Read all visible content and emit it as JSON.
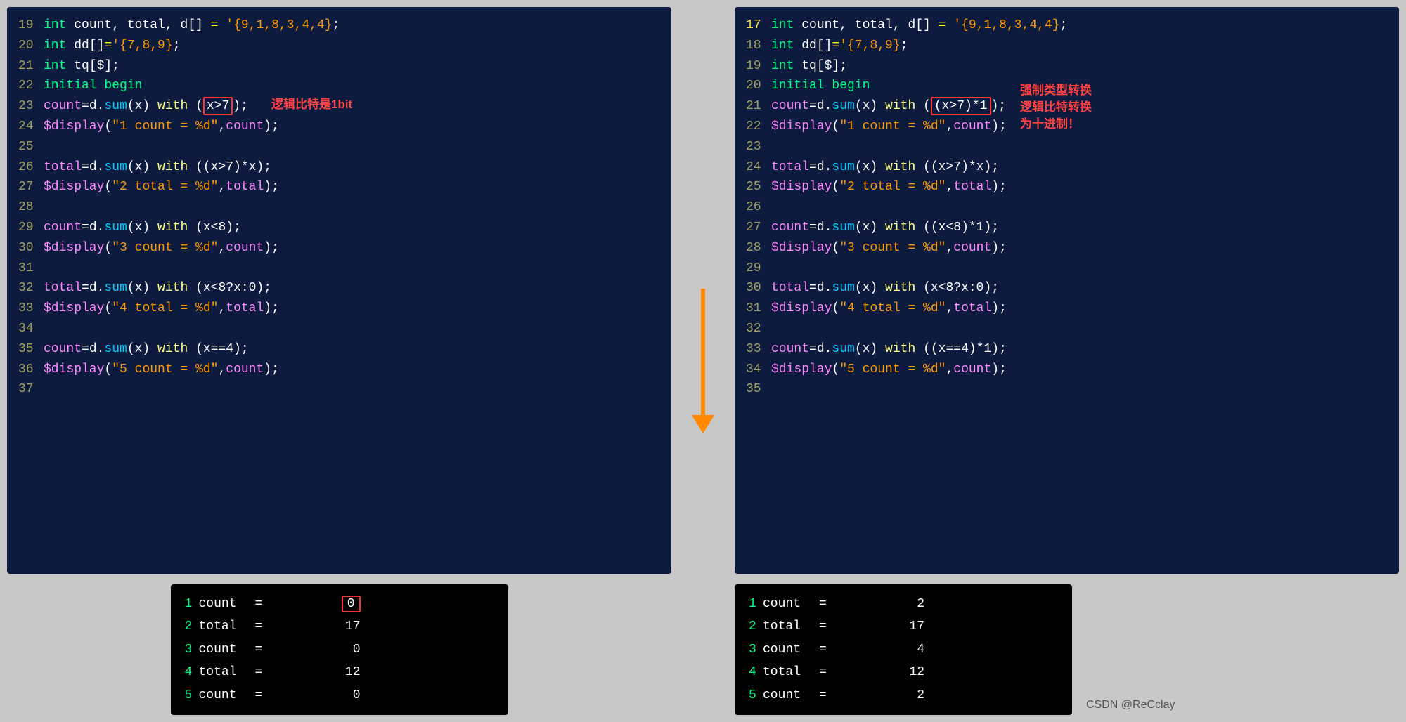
{
  "left": {
    "code": {
      "lines": [
        {
          "num": "19",
          "text": "int count, total, d[] = '{9,1,8,3,4,4};"
        },
        {
          "num": "20",
          "text": "int dd[]='{7,8,9};"
        },
        {
          "num": "21",
          "text": "int tq[$];"
        },
        {
          "num": "22",
          "text": "initial begin"
        },
        {
          "num": "23",
          "text": "count=d.sum(x) with (x>7);"
        },
        {
          "num": "24",
          "text": "$display(\"1 count = %d\",count);"
        },
        {
          "num": "25",
          "text": ""
        },
        {
          "num": "26",
          "text": "total=d.sum(x) with ((x>7)*x);"
        },
        {
          "num": "27",
          "text": "$display(\"2 total = %d\",total);"
        },
        {
          "num": "28",
          "text": ""
        },
        {
          "num": "29",
          "text": "count=d.sum(x) with (x<8);"
        },
        {
          "num": "30",
          "text": "$display(\"3 count = %d\",count);"
        },
        {
          "num": "31",
          "text": ""
        },
        {
          "num": "32",
          "text": "total=d.sum(x) with (x<8?x:0);"
        },
        {
          "num": "33",
          "text": "$display(\"4 total = %d\",total);"
        },
        {
          "num": "34",
          "text": ""
        },
        {
          "num": "35",
          "text": "count=d.sum(x) with (x==4);"
        },
        {
          "num": "36",
          "text": "$display(\"5 count = %d\",count);"
        },
        {
          "num": "37",
          "text": ""
        }
      ]
    },
    "annotation": "逻辑比特是1bit",
    "highlight": "(x>7)",
    "output": {
      "lines": [
        {
          "num": "1",
          "label": "count",
          "eq": "=",
          "val": "0",
          "highlighted": true
        },
        {
          "num": "2",
          "label": "total",
          "eq": "=",
          "val": "17",
          "highlighted": false
        },
        {
          "num": "3",
          "label": "count",
          "eq": "=",
          "val": "0",
          "highlighted": false
        },
        {
          "num": "4",
          "label": "total",
          "eq": "=",
          "val": "12",
          "highlighted": false
        },
        {
          "num": "5",
          "label": "count",
          "eq": "=",
          "val": "0",
          "highlighted": false
        }
      ]
    }
  },
  "right": {
    "code": {
      "lines": [
        {
          "num": "17",
          "text": "int count, total, d[] = '{9,1,8,3,4,4};"
        },
        {
          "num": "18",
          "text": "int dd[]='{7,8,9};"
        },
        {
          "num": "19",
          "text": "int tq[$];"
        },
        {
          "num": "20",
          "text": "initial begin"
        },
        {
          "num": "21",
          "text": "count=d.sum(x) with ((x>7)*1);"
        },
        {
          "num": "22",
          "text": "$display(\"1 count = %d\",count);"
        },
        {
          "num": "23",
          "text": ""
        },
        {
          "num": "24",
          "text": "total=d.sum(x) with ((x>7)*x);"
        },
        {
          "num": "25",
          "text": "$display(\"2 total = %d\",total);"
        },
        {
          "num": "26",
          "text": ""
        },
        {
          "num": "27",
          "text": "count=d.sum(x) with ((x<8)*1);"
        },
        {
          "num": "28",
          "text": "$display(\"3 count = %d\",count);"
        },
        {
          "num": "29",
          "text": ""
        },
        {
          "num": "30",
          "text": "total=d.sum(x) with (x<8?x:0);"
        },
        {
          "num": "31",
          "text": "$display(\"4 total = %d\",total);"
        },
        {
          "num": "32",
          "text": ""
        },
        {
          "num": "33",
          "text": "count=d.sum(x) with ((x==4)*1);"
        },
        {
          "num": "34",
          "text": "$display(\"5 count = %d\",count);"
        },
        {
          "num": "35",
          "text": ""
        }
      ]
    },
    "annotation1": "强制类型转换",
    "annotation2": "逻辑比特转换",
    "annotation3": "为十进制！",
    "highlight": "((x>7)*1)",
    "output": {
      "lines": [
        {
          "num": "1",
          "label": "count",
          "eq": "=",
          "val": "2",
          "highlighted": false
        },
        {
          "num": "2",
          "label": "total",
          "eq": "=",
          "val": "17",
          "highlighted": false
        },
        {
          "num": "3",
          "label": "count",
          "eq": "=",
          "val": "4",
          "highlighted": false
        },
        {
          "num": "4",
          "label": "total",
          "eq": "=",
          "val": "12",
          "highlighted": false
        },
        {
          "num": "5",
          "label": "count",
          "eq": "=",
          "val": "2",
          "highlighted": false
        }
      ]
    }
  },
  "watermark": "CSDN @ReCclay"
}
